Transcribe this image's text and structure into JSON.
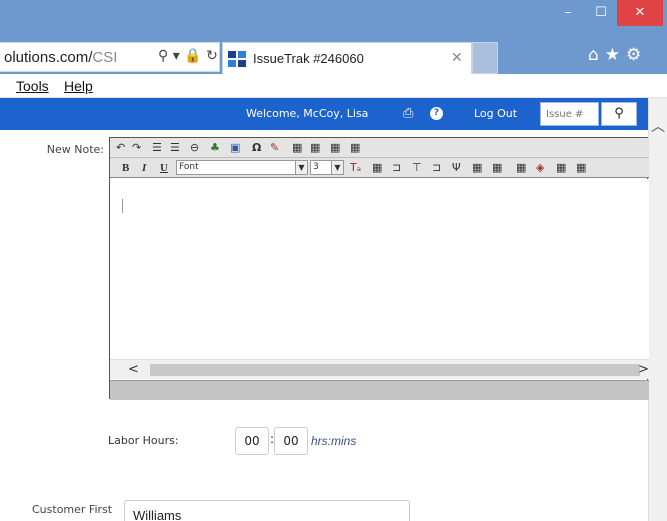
{
  "window": {
    "minimize_glyph": "–",
    "maximize_glyph": "☐",
    "close_glyph": "✕"
  },
  "address_bar": {
    "url_visible": "olutions.com/",
    "url_dim": "CSI",
    "icons": "⚲ ▾ 🔒 ↻"
  },
  "tab": {
    "title": "IssueTrak #246060",
    "close_glyph": "✕"
  },
  "browser_nav": {
    "icons": "⌂★⚙"
  },
  "menu": {
    "tools": "Tools",
    "help": "Help"
  },
  "app_header": {
    "welcome": "Welcome, McCoy, Lisa",
    "print_icon_glyph": "⎙",
    "help_icon_glyph": "?",
    "logout": "Log Out",
    "issue_placeholder": "Issue #",
    "search_glyph": "⚲"
  },
  "form": {
    "new_note_label": "New Note:",
    "labor_hours_label": "Labor Hours:",
    "hours_value": "00",
    "minutes_value": "00",
    "time_separator": ":",
    "hrs_mins_hint": "hrs:mins",
    "customer_first_label": "Customer First",
    "customer_first_value": "Williams"
  },
  "editor_toolbar": {
    "row1": [
      "↶",
      "↷",
      "☰",
      "☰",
      "⊖",
      "♣",
      "▣",
      "Ω",
      "✎",
      "▦",
      "▦",
      "▦",
      "▦"
    ],
    "row2_bold": "B",
    "row2_italic": "I",
    "row2_underline": "U",
    "font_select": "Font",
    "size_select": "3",
    "row2_icons": [
      "Tₐ",
      "▦",
      "⊐",
      "⊤",
      "⊐",
      "Ψ",
      "▦",
      "▦",
      "▦",
      "◈",
      "▦",
      "▦"
    ]
  },
  "scroll": {
    "up_glyph": "︿",
    "left_glyph": "<",
    "right_glyph": ">"
  },
  "colors": {
    "titlebar": "#6d99cf",
    "app_header": "#1c63ce",
    "close_button": "#e04343"
  }
}
